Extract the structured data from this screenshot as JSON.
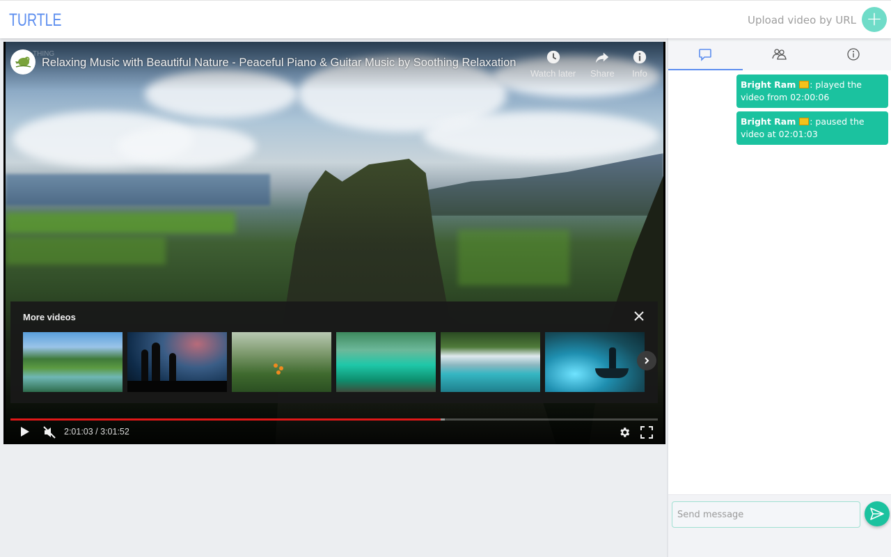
{
  "app": {
    "logo": "TURTLE",
    "upload_label": "Upload video by URL",
    "upload_button_icon": "plus-icon",
    "accent_color": "#5b8def",
    "teal_color": "#1bc29f"
  },
  "player": {
    "channel_faint_text": "THING",
    "title": "Relaxing Music with Beautiful Nature - Peaceful Piano & Guitar Music by Soothing Relaxation",
    "top_actions": [
      {
        "label": "Watch later",
        "icon": "clock-icon"
      },
      {
        "label": "Share",
        "icon": "share-arrow-icon"
      },
      {
        "label": "Info",
        "icon": "info-icon"
      }
    ],
    "more_videos": {
      "title": "More videos",
      "thumbnails": [
        {
          "scene": "alpine river with snowy mountains"
        },
        {
          "scene": "cactus silhouettes under milky way"
        },
        {
          "scene": "misty redwood forest with orange flowers"
        },
        {
          "scene": "turquoise lagoon in jungle"
        },
        {
          "scene": "waterfall into turquoise pool"
        },
        {
          "scene": "figure on boat under starry sky"
        }
      ]
    },
    "current_time": "2:01:03",
    "duration": "3:01:52",
    "time_display": "2:01:03 / 3:01:52",
    "progress_fraction": 0.6645,
    "state": "paused",
    "muted": true
  },
  "sidebar": {
    "tabs": [
      {
        "name": "chat",
        "icon": "chat-bubble-icon",
        "active": true
      },
      {
        "name": "users",
        "icon": "users-icon",
        "active": false
      },
      {
        "name": "info",
        "icon": "info-icon",
        "active": false
      }
    ],
    "messages": [
      {
        "user": "Bright Ram",
        "badge": "crown-icon",
        "text": ": played the video from 02:00:06"
      },
      {
        "user": "Bright Ram",
        "badge": "crown-icon",
        "text": ": paused the video at 02:01:03"
      }
    ],
    "composer": {
      "placeholder": "Send message",
      "value": ""
    }
  }
}
